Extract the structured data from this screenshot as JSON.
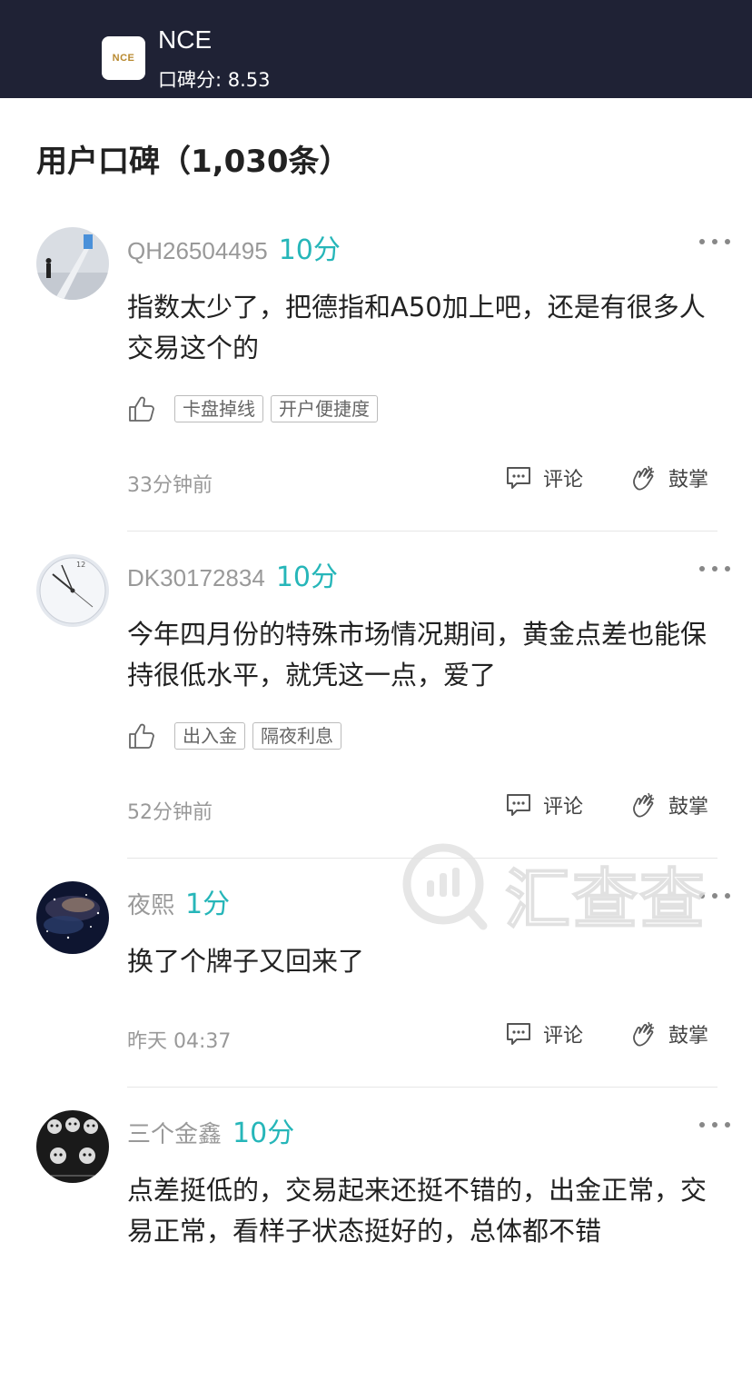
{
  "header": {
    "logo_text": "NCE",
    "app_name": "NCE",
    "rating": "口碑分: 8.53",
    "background": "#1f2235"
  },
  "section_title": "用户口碑（1,030条）",
  "actions": {
    "comment_label": "评论",
    "clap_label": "鼓掌"
  },
  "accent_color": "#26b6b9",
  "reviews": [
    {
      "user": "QH26504495",
      "score": "10分",
      "content": "指数太少了，把德指和A50加上吧，还是有很多人交易这个的",
      "tags": [
        "卡盘掉线",
        "开户便捷度"
      ],
      "time": "33分钟前",
      "avatar": "stairs-photo"
    },
    {
      "user": "DK30172834",
      "score": "10分",
      "content": "今年四月份的特殊市场情况期间，黄金点差也能保持很低水平，就凭这一点，爱了",
      "tags": [
        "出入金",
        "隔夜利息"
      ],
      "time": "52分钟前",
      "avatar": "clock-photo"
    },
    {
      "user": "夜熙",
      "score": "1分",
      "content": "换了个牌子又回来了",
      "tags": [],
      "time": "昨天 04:37",
      "avatar": "galaxy-photo"
    },
    {
      "user": "三个金鑫",
      "score": "10分",
      "content": "点差挺低的，交易起来还挺不错的，出金正常，交易正常，看样子状态挺好的，总体都不错",
      "tags": [],
      "time": "",
      "avatar": "animals-photo"
    }
  ],
  "watermark": {
    "text": "汇查查",
    "icon": "chart-magnifier-icon"
  }
}
